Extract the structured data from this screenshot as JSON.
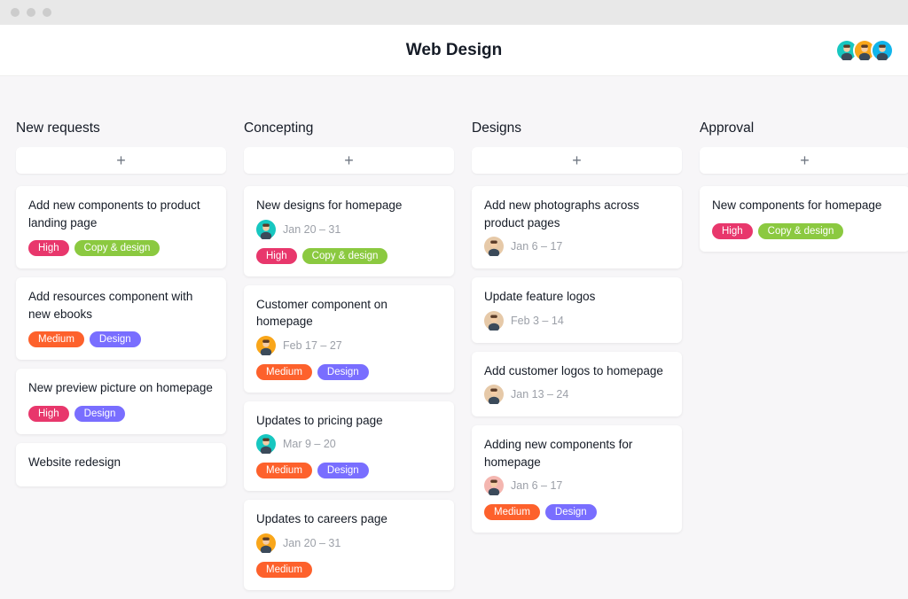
{
  "header": {
    "title": "Web Design",
    "avatars": [
      {
        "bg": "#17c7c0"
      },
      {
        "bg": "#f9a61a"
      },
      {
        "bg": "#12b5eb"
      }
    ]
  },
  "tag_colors": {
    "High": "#e8376c",
    "Medium": "#fd612c",
    "Copy & design": "#8bc940",
    "Design": "#796eff"
  },
  "avatar_colors": {
    "teal": "#17c7c0",
    "orange": "#f9a61a",
    "tan": "#e6c9a8",
    "pink": "#f4b6b0"
  },
  "columns": [
    {
      "title": "New requests",
      "cards": [
        {
          "title": "Add new components to product landing page",
          "tags": [
            "High",
            "Copy & design"
          ]
        },
        {
          "title": "Add resources component with new ebooks",
          "tags": [
            "Medium",
            "Design"
          ]
        },
        {
          "title": "New preview picture on homepage",
          "tags": [
            "High",
            "Design"
          ]
        },
        {
          "title": "Website redesign",
          "tags": []
        }
      ]
    },
    {
      "title": "Concepting",
      "cards": [
        {
          "title": "New designs for homepage",
          "avatar": "teal",
          "date": "Jan 20 – 31",
          "tags": [
            "High",
            "Copy & design"
          ]
        },
        {
          "title": "Customer component on homepage",
          "avatar": "orange",
          "date": "Feb 17 – 27",
          "tags": [
            "Medium",
            "Design"
          ]
        },
        {
          "title": "Updates to pricing page",
          "avatar": "teal",
          "date": "Mar 9 – 20",
          "tags": [
            "Medium",
            "Design"
          ]
        },
        {
          "title": "Updates to careers page",
          "avatar": "orange",
          "date": "Jan 20 – 31",
          "tags": [
            "Medium"
          ]
        }
      ]
    },
    {
      "title": "Designs",
      "cards": [
        {
          "title": "Add new photographs across product pages",
          "avatar": "tan",
          "date": "Jan 6 – 17",
          "tags": []
        },
        {
          "title": "Update feature logos",
          "avatar": "tan",
          "date": "Feb 3 – 14",
          "tags": []
        },
        {
          "title": "Add customer logos to homepage",
          "avatar": "tan",
          "date": "Jan 13 – 24",
          "tags": []
        },
        {
          "title": "Adding new components for homepage",
          "avatar": "pink",
          "date": "Jan 6 – 17",
          "tags": [
            "Medium",
            "Design"
          ]
        }
      ]
    },
    {
      "title": "Approval",
      "cards": [
        {
          "title": "New components for homepage",
          "tags": [
            "High",
            "Copy & design"
          ]
        }
      ]
    }
  ]
}
